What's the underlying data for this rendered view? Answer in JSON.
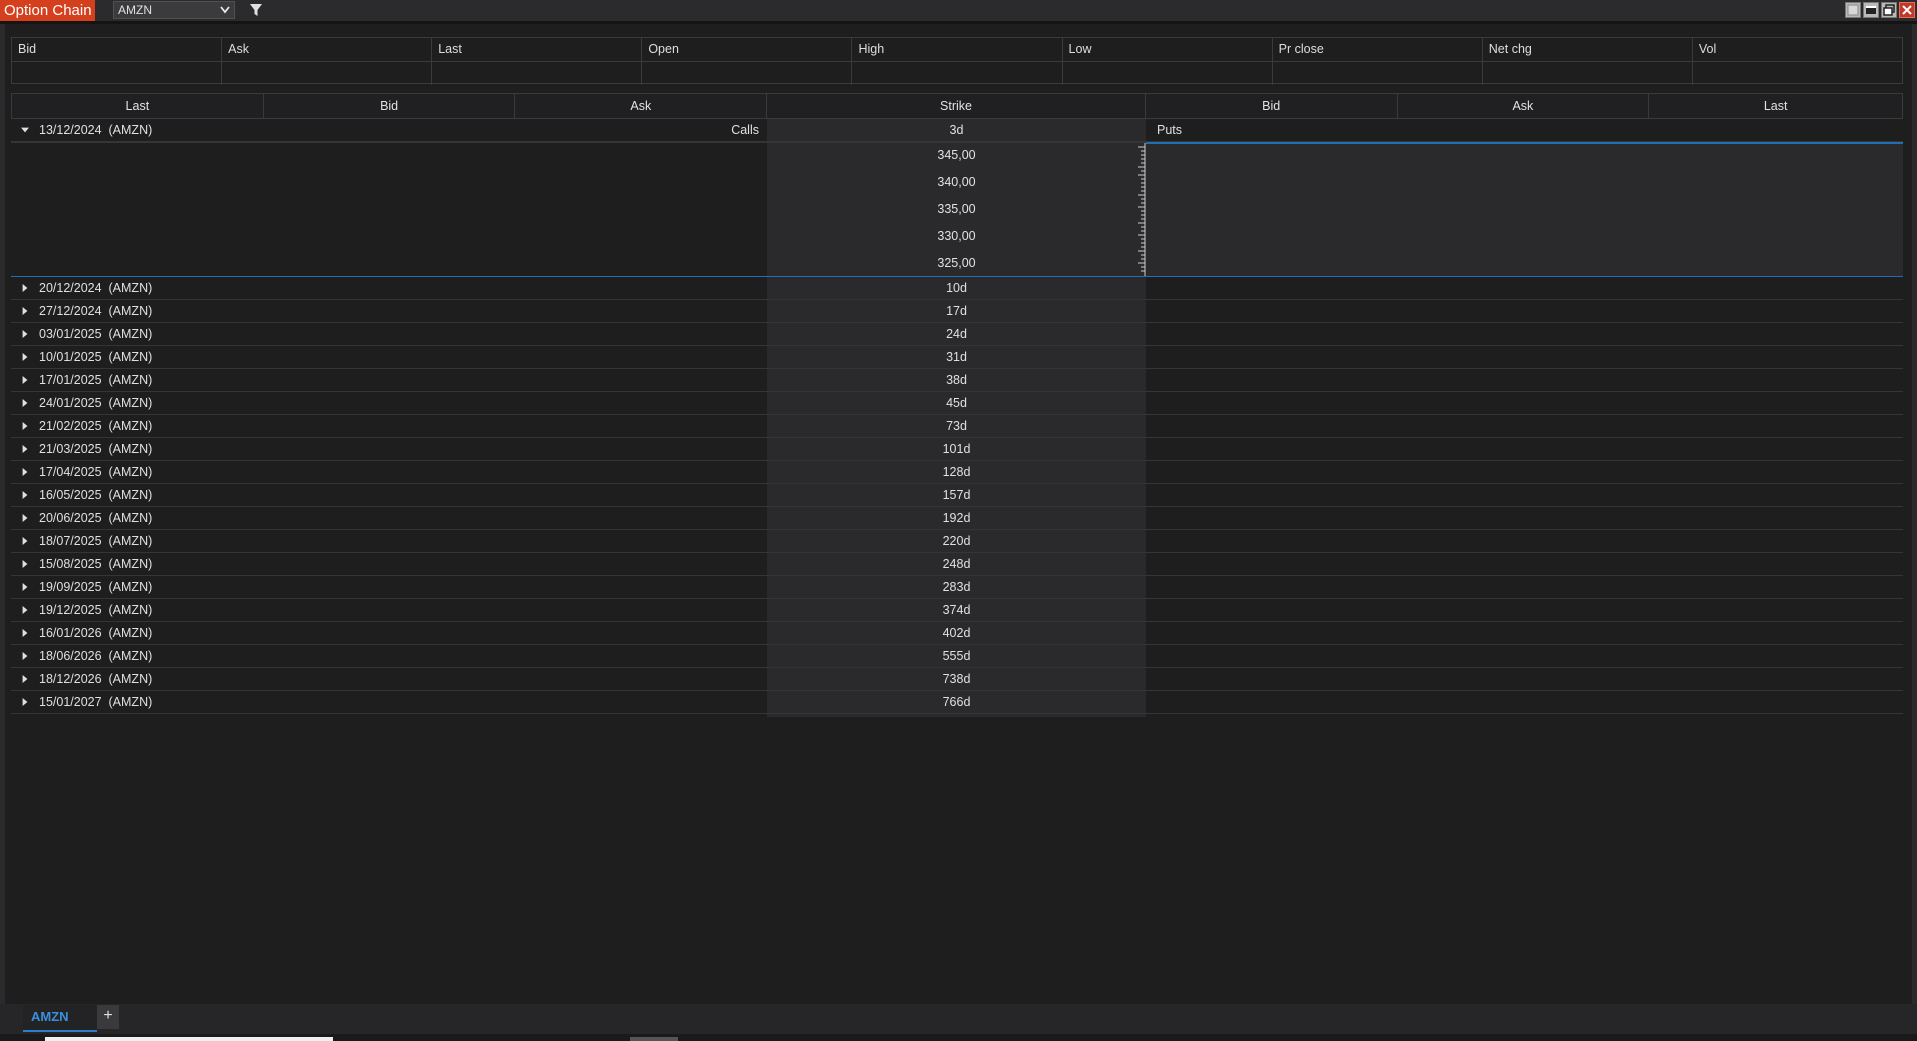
{
  "window": {
    "title": "Option Chain"
  },
  "toolbar": {
    "symbol": "AMZN",
    "filter_icon": "filter-icon"
  },
  "window_buttons": [
    "restore-icon",
    "minimize-icon",
    "maximize-icon",
    "close-icon"
  ],
  "quote": {
    "headers": [
      "Bid",
      "Ask",
      "Last",
      "Open",
      "High",
      "Low",
      "Pr close",
      "Net chg",
      "Vol"
    ],
    "values": [
      "",
      "",
      "",
      "",
      "",
      "",
      "",
      "",
      ""
    ]
  },
  "chain": {
    "columns": [
      "Last",
      "Bid",
      "Ask",
      "Strike",
      "Bid",
      "Ask",
      "Last"
    ],
    "calls_label": "Calls",
    "puts_label": "Puts",
    "expanded": {
      "date": "13/12/2024",
      "symbol": "(AMZN)",
      "days": "3d",
      "strikes": [
        "345,00",
        "340,00",
        "335,00",
        "330,00",
        "325,00"
      ]
    },
    "expiries": [
      {
        "date": "20/12/2024",
        "symbol": "(AMZN)",
        "days": "10d"
      },
      {
        "date": "27/12/2024",
        "symbol": "(AMZN)",
        "days": "17d"
      },
      {
        "date": "03/01/2025",
        "symbol": "(AMZN)",
        "days": "24d"
      },
      {
        "date": "10/01/2025",
        "symbol": "(AMZN)",
        "days": "31d"
      },
      {
        "date": "17/01/2025",
        "symbol": "(AMZN)",
        "days": "38d"
      },
      {
        "date": "24/01/2025",
        "symbol": "(AMZN)",
        "days": "45d"
      },
      {
        "date": "21/02/2025",
        "symbol": "(AMZN)",
        "days": "73d"
      },
      {
        "date": "21/03/2025",
        "symbol": "(AMZN)",
        "days": "101d"
      },
      {
        "date": "17/04/2025",
        "symbol": "(AMZN)",
        "days": "128d"
      },
      {
        "date": "16/05/2025",
        "symbol": "(AMZN)",
        "days": "157d"
      },
      {
        "date": "20/06/2025",
        "symbol": "(AMZN)",
        "days": "192d"
      },
      {
        "date": "18/07/2025",
        "symbol": "(AMZN)",
        "days": "220d"
      },
      {
        "date": "15/08/2025",
        "symbol": "(AMZN)",
        "days": "248d"
      },
      {
        "date": "19/09/2025",
        "symbol": "(AMZN)",
        "days": "283d"
      },
      {
        "date": "19/12/2025",
        "symbol": "(AMZN)",
        "days": "374d"
      },
      {
        "date": "16/01/2026",
        "symbol": "(AMZN)",
        "days": "402d"
      },
      {
        "date": "18/06/2026",
        "symbol": "(AMZN)",
        "days": "555d"
      },
      {
        "date": "18/12/2026",
        "symbol": "(AMZN)",
        "days": "738d"
      },
      {
        "date": "15/01/2027",
        "symbol": "(AMZN)",
        "days": "766d"
      }
    ]
  },
  "tabs": {
    "items": [
      "AMZN"
    ],
    "add_label": "+"
  }
}
